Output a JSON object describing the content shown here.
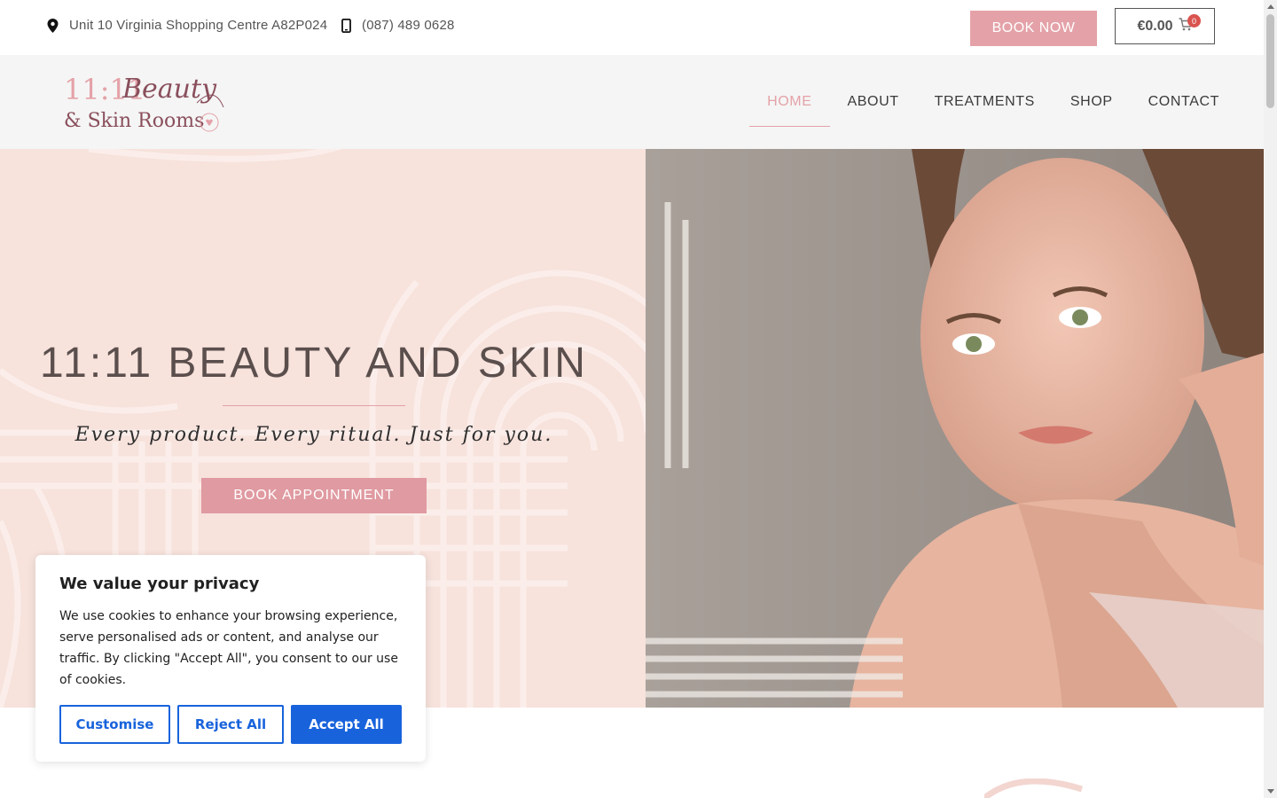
{
  "topbar": {
    "address": "Unit 10 Virginia Shopping Centre A82P024",
    "phone": "(087) 489 0628",
    "book_now_label": "BOOK NOW",
    "cart_total": "€0.00",
    "cart_count": "0",
    "icons": [
      "location-pin-icon",
      "phone-icon",
      "cart-icon"
    ]
  },
  "header": {
    "logo_text_line1": "11:11 Beauty",
    "logo_text_line2": "& Skin Rooms",
    "nav": [
      {
        "label": "HOME",
        "active": true
      },
      {
        "label": "ABOUT",
        "active": false
      },
      {
        "label": "TREATMENTS",
        "active": false
      },
      {
        "label": "SHOP",
        "active": false
      },
      {
        "label": "CONTACT",
        "active": false
      }
    ]
  },
  "hero": {
    "title": "11:11 BEAUTY AND SKIN",
    "tagline": "Every product. Every ritual. Just for you.",
    "cta_label": "BOOK APPOINTMENT"
  },
  "cookie": {
    "title": "We value your privacy",
    "body": "We use cookies to enhance your browsing experience, serve personalised ads or content, and analyse our traffic. By clicking \"Accept All\", you consent to our use of cookies.",
    "customise_label": "Customise",
    "reject_label": "Reject All",
    "accept_label": "Accept All"
  },
  "colors": {
    "brand_pink": "#e4a2a8",
    "hero_bg": "#f7e2dc",
    "header_bg": "#f5f5f5",
    "cookie_blue": "#1863dc",
    "cart_badge": "#d9534f"
  }
}
